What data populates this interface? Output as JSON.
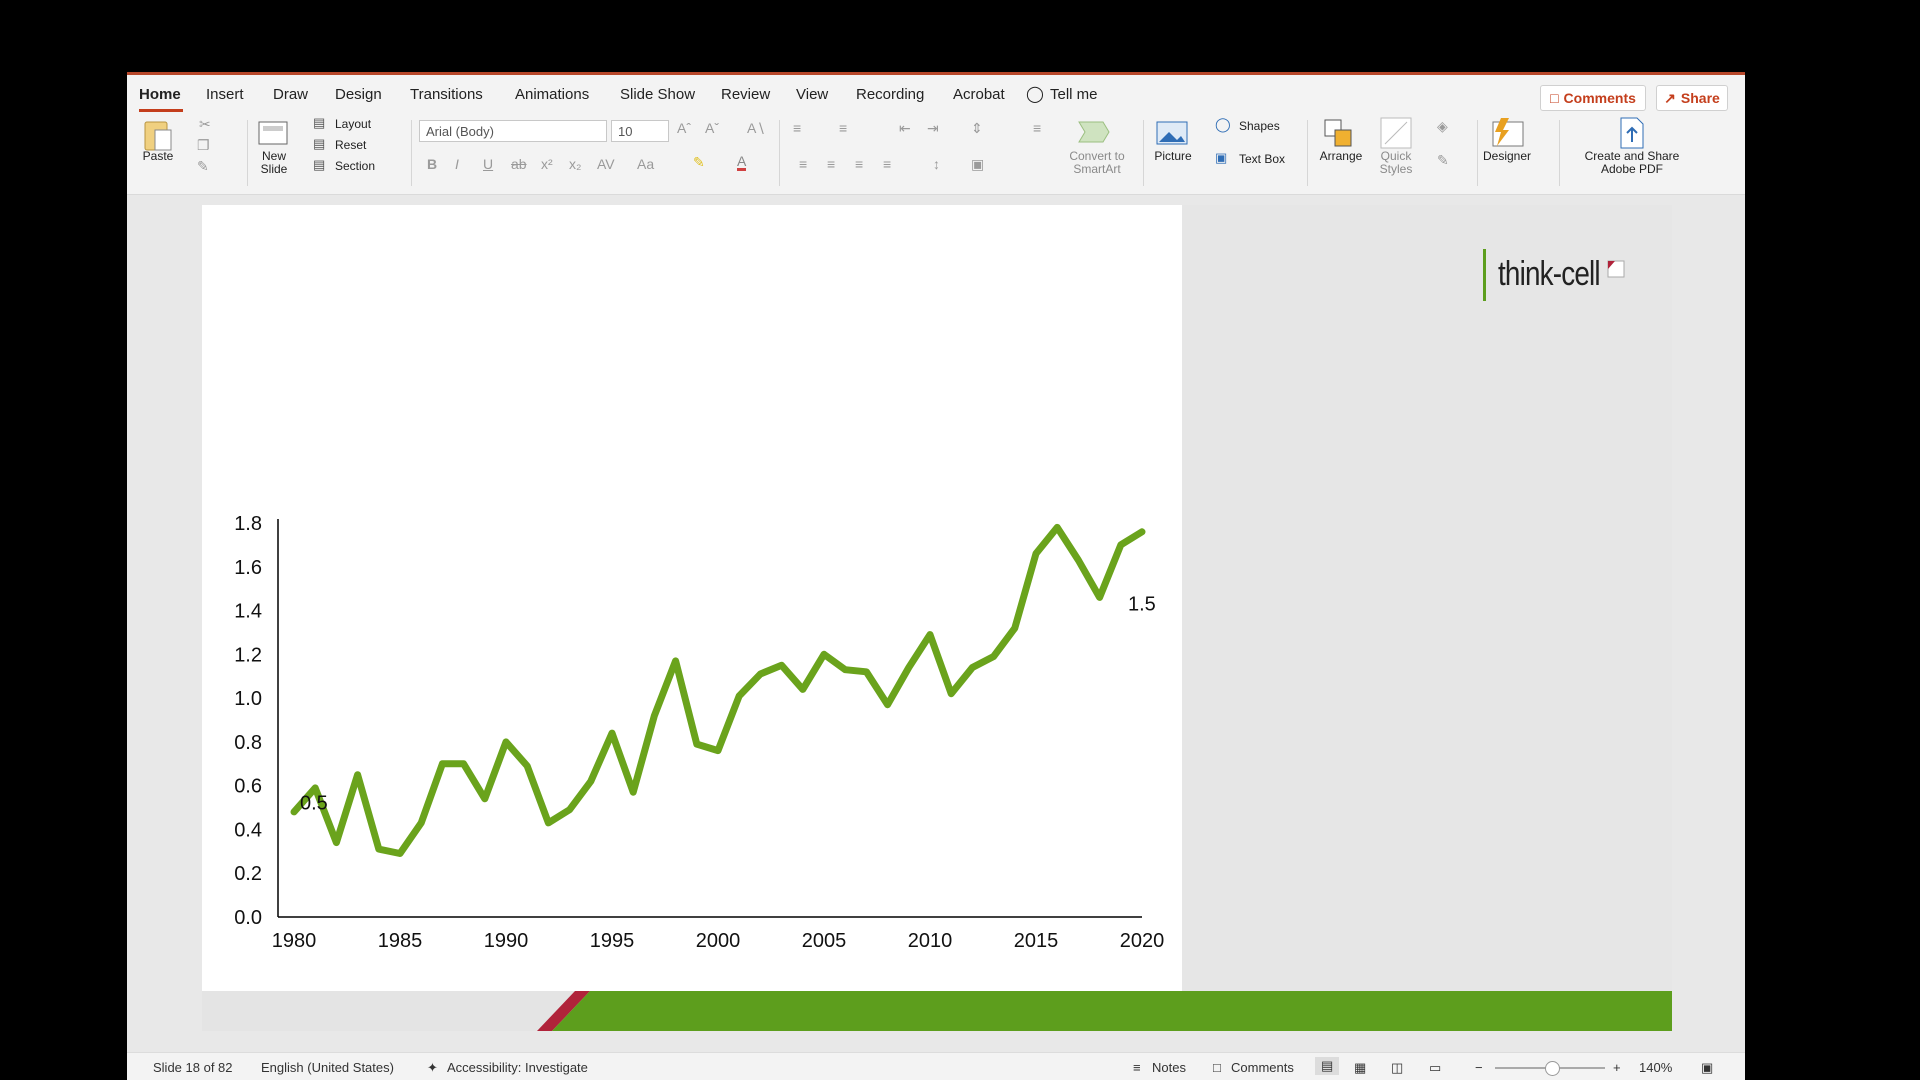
{
  "tabs": [
    "Home",
    "Insert",
    "Draw",
    "Design",
    "Transitions",
    "Animations",
    "Slide Show",
    "Review",
    "View",
    "Recording",
    "Acrobat",
    "Tell me"
  ],
  "topright": {
    "comments": "Comments",
    "share": "Share"
  },
  "ribbon": {
    "paste": "Paste",
    "new_slide": [
      "New",
      "Slide"
    ],
    "layout": "Layout",
    "reset": "Reset",
    "section": "Section",
    "font_name": "Arial (Body)",
    "font_size": "10",
    "convert_smartart": [
      "Convert to",
      "SmartArt"
    ],
    "picture": "Picture",
    "shapes": "Shapes",
    "text_box": "Text Box",
    "arrange": "Arrange",
    "quick_styles": [
      "Quick",
      "Styles"
    ],
    "designer": "Designer",
    "create_share": [
      "Create and Share",
      "Adobe PDF"
    ]
  },
  "logo": {
    "text": "think-cell"
  },
  "status": {
    "slide": "Slide 18 of 82",
    "language": "English (United States)",
    "accessibility": "Accessibility: Investigate",
    "notes": "Notes",
    "comments": "Comments",
    "zoom": "140%"
  },
  "colors": {
    "accent": "#c43e1c",
    "series": "#6aa31c",
    "logo_red": "#b0233a",
    "logo_green": "#5d9e1d"
  },
  "chart_data": {
    "type": "line",
    "title": "",
    "xlabel": "",
    "ylabel": "",
    "xlim": [
      1980,
      2020
    ],
    "ylim": [
      0,
      1.8
    ],
    "x_ticks": [
      "1980",
      "1985",
      "1990",
      "1995",
      "2000",
      "2005",
      "2010",
      "2015",
      "2020"
    ],
    "y_ticks": [
      "0.0",
      "0.2",
      "0.4",
      "0.6",
      "0.8",
      "1.0",
      "1.2",
      "1.4",
      "1.6",
      "1.8"
    ],
    "series": [
      {
        "values_x": [
          1980,
          1981,
          1982,
          1983,
          1984,
          1985,
          1986,
          1987,
          1988,
          1989,
          1990,
          1991,
          1992,
          1993,
          1994,
          1995,
          1996,
          1997,
          1998,
          1999,
          2000,
          2001,
          2002,
          2003,
          2004,
          2005,
          2006,
          2007,
          2008,
          2009,
          2010,
          2011,
          2012,
          2013,
          2014,
          2015,
          2016,
          2017,
          2018,
          2019,
          2020
        ],
        "values_y": [
          0.48,
          0.59,
          0.34,
          0.65,
          0.31,
          0.29,
          0.43,
          0.7,
          0.7,
          0.54,
          0.8,
          0.69,
          0.43,
          0.49,
          0.62,
          0.84,
          0.57,
          0.92,
          1.17,
          0.79,
          0.76,
          1.01,
          1.11,
          1.15,
          1.04,
          1.2,
          1.13,
          1.12,
          0.97,
          1.14,
          1.29,
          1.02,
          1.14,
          1.19,
          1.32,
          1.66,
          1.78,
          1.63,
          1.46,
          1.7,
          1.76
        ]
      }
    ],
    "data_labels": [
      {
        "x": 1980,
        "text": "0.5"
      },
      {
        "x": 2020,
        "text": "1.5"
      }
    ],
    "grid": false,
    "legend": "none"
  }
}
